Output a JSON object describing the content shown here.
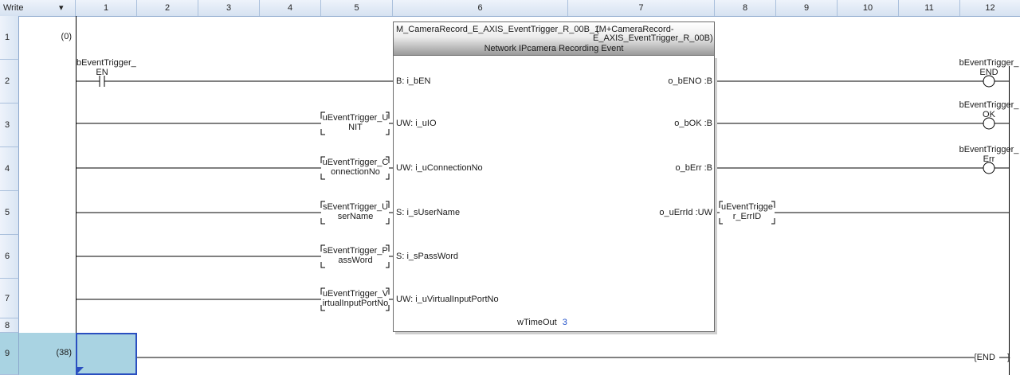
{
  "header": {
    "mode_label": "Write",
    "dropdown_glyph": "▾",
    "columns": [
      "1",
      "2",
      "3",
      "4",
      "5",
      "6",
      "7",
      "8",
      "9",
      "10",
      "11",
      "12"
    ]
  },
  "rows": [
    "1",
    "2",
    "3",
    "4",
    "5",
    "6",
    "7",
    "8",
    "9"
  ],
  "step_numbers": {
    "first": "(0)",
    "second": "(38)"
  },
  "contact_en": {
    "line1": "bEventTrigger_",
    "line2": "EN"
  },
  "inputs": [
    {
      "line1": "uEventTrigger_U",
      "line2": "NIT"
    },
    {
      "line1": "uEventTrigger_C",
      "line2": "onnectionNo"
    },
    {
      "line1": "sEventTrigger_U",
      "line2": "serName"
    },
    {
      "line1": "sEventTrigger_P",
      "line2": "assWord"
    },
    {
      "line1": "uEventTrigger_V",
      "line2": "irtualInputPortNo"
    }
  ],
  "function_block": {
    "instance": "M_CameraRecord_E_AXIS_EventTrigger_R_00B_1",
    "type_line1": "(M+CameraRecord-",
    "type_line2": "E_AXIS_EventTrigger_R_00B)",
    "subtitle": "Network IPcamera Recording Event",
    "in_pins": [
      "B: i_bEN",
      "UW: i_uIO",
      "UW: i_uConnectionNo",
      "S: i_sUserName",
      "S: i_sPassWord",
      "UW: i_uVirtualInputPortNo"
    ],
    "out_pins": [
      "o_bENO :B",
      "o_bOK :B",
      "o_bErr :B",
      "o_uErrId :UW"
    ],
    "param_label": "wTimeOut",
    "param_value": "3"
  },
  "err_id_output": {
    "line1": "uEventTrigge",
    "line2": "r_ErrID"
  },
  "coils": [
    {
      "line1": "bEventTrigger_",
      "line2": "END"
    },
    {
      "line1": "bEventTrigger_",
      "line2": "OK"
    },
    {
      "line1": "bEventTrigger_",
      "line2": "Err"
    }
  ],
  "end_instruction": "{END",
  "end_close": "}"
}
